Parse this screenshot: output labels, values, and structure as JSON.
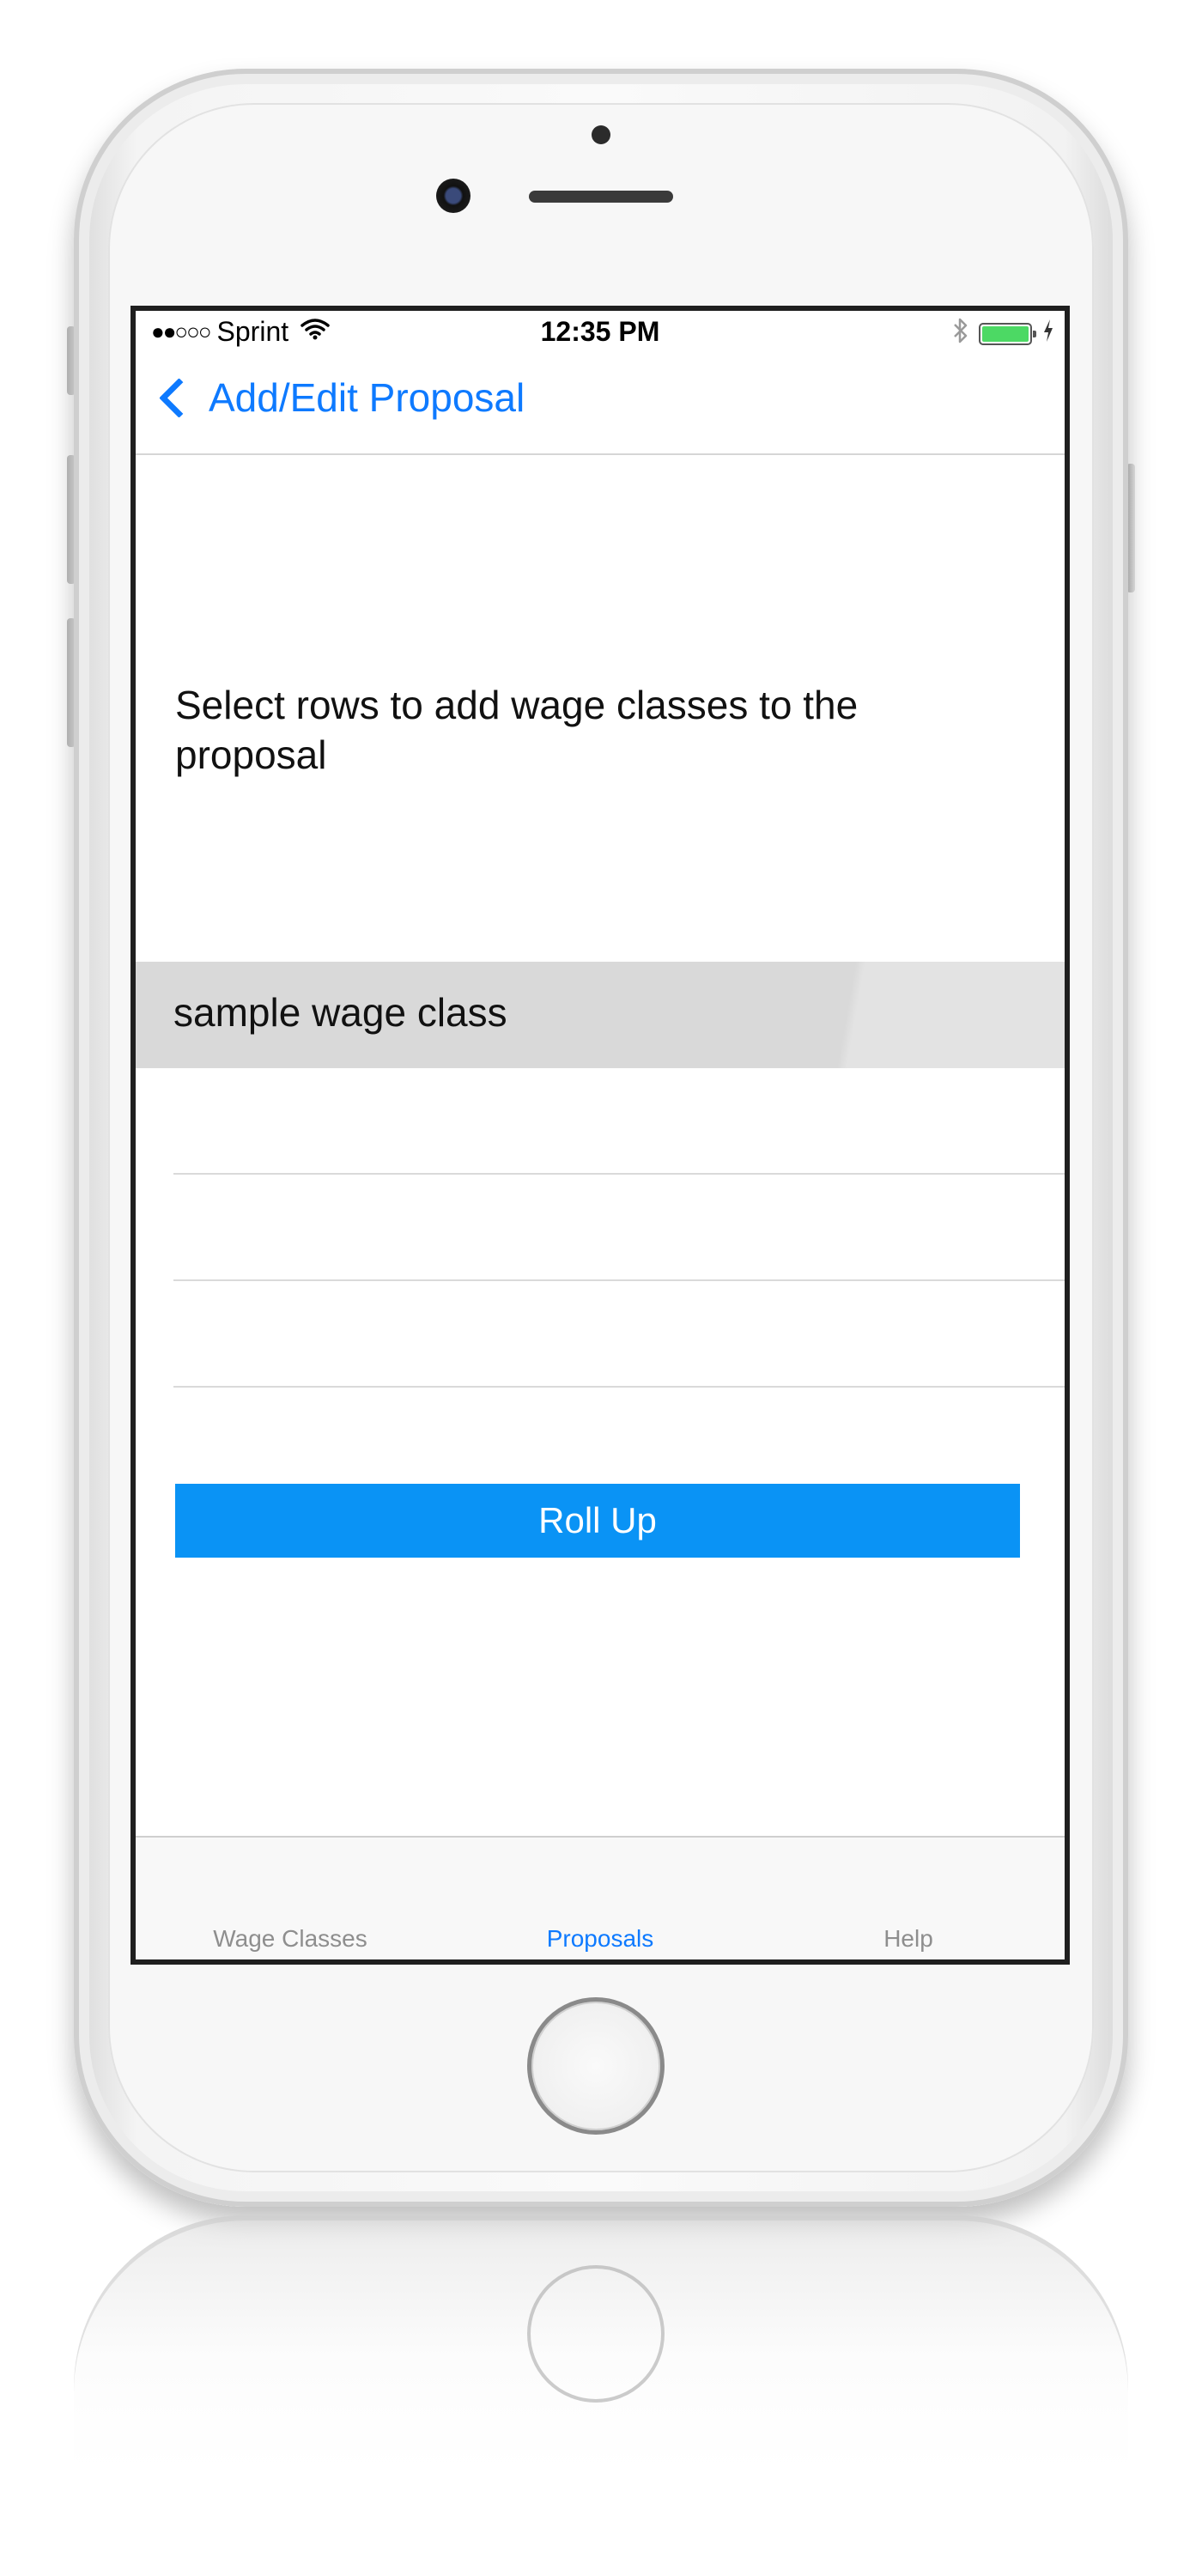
{
  "status_bar": {
    "signal": "●●○○○",
    "carrier": "Sprint",
    "wifi_icon": "wifi-icon",
    "time": "12:35 PM",
    "bluetooth_icon": "bluetooth-icon",
    "battery_icon": "battery-icon",
    "charging_icon": "bolt-icon"
  },
  "nav": {
    "back_label": "Add/Edit Proposal"
  },
  "content": {
    "instruction": "Select rows to add wage classes to the proposal",
    "rows": [
      {
        "label": "sample wage class",
        "selected": true
      },
      {
        "label": "",
        "selected": false
      },
      {
        "label": "",
        "selected": false
      },
      {
        "label": "",
        "selected": false
      }
    ],
    "rollup_label": "Roll Up"
  },
  "tab_bar": {
    "tabs": [
      {
        "label": "Wage Classes",
        "active": false
      },
      {
        "label": "Proposals",
        "active": true
      },
      {
        "label": "Help",
        "active": false
      }
    ]
  },
  "colors": {
    "accent": "#0e7aff",
    "button": "#0a93f5",
    "selected_row": "#d9d9d9"
  }
}
